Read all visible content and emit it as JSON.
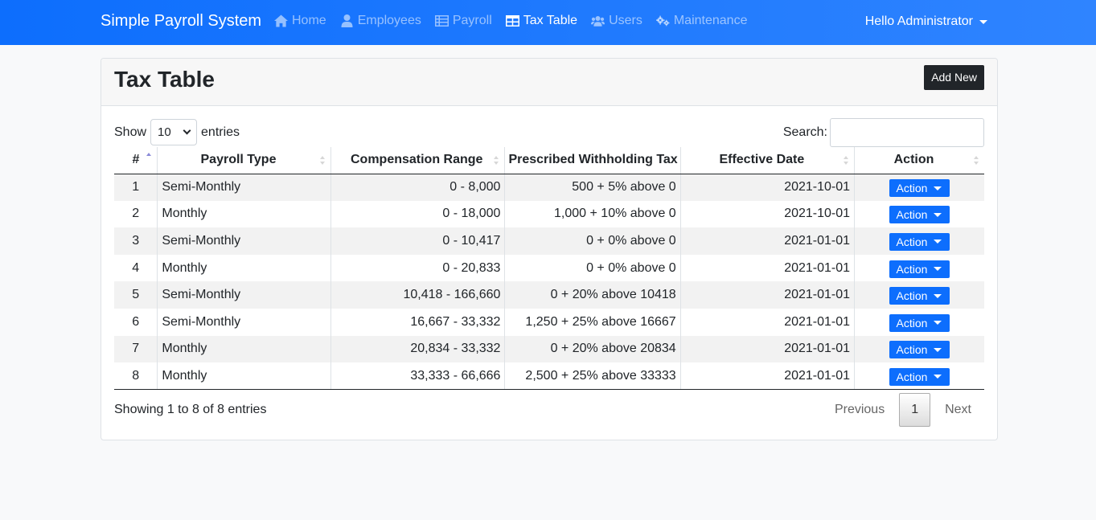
{
  "navbar": {
    "brand": "Simple Payroll System",
    "items": [
      {
        "label": "Home",
        "icon": "home-icon"
      },
      {
        "label": "Employees",
        "icon": "user-icon"
      },
      {
        "label": "Payroll",
        "icon": "table-list-icon"
      },
      {
        "label": "Tax Table",
        "icon": "table-icon",
        "active": true
      },
      {
        "label": "Users",
        "icon": "users-icon"
      },
      {
        "label": "Maintenance",
        "icon": "gears-icon"
      }
    ],
    "user_label": "Hello Administrator"
  },
  "page": {
    "title": "Tax Table",
    "add_button": "Add New"
  },
  "table_controls": {
    "show_label": "Show",
    "page_size": "10",
    "entries_label": "entries",
    "search_label": "Search:",
    "search_value": ""
  },
  "table": {
    "columns": [
      "#",
      "Payroll Type",
      "Compensation Range",
      "Prescribed Withholding Tax",
      "Effective Date",
      "Action"
    ],
    "action_label": "Action",
    "rows": [
      {
        "num": "1",
        "type": "Semi-Monthly",
        "range": "0 - 8,000",
        "tax": "500 + 5% above 0",
        "date": "2021-10-01"
      },
      {
        "num": "2",
        "type": "Monthly",
        "range": "0 - 18,000",
        "tax": "1,000 + 10% above 0",
        "date": "2021-10-01"
      },
      {
        "num": "3",
        "type": "Semi-Monthly",
        "range": "0 - 10,417",
        "tax": "0 + 0% above 0",
        "date": "2021-01-01"
      },
      {
        "num": "4",
        "type": "Monthly",
        "range": "0 - 20,833",
        "tax": "0 + 0% above 0",
        "date": "2021-01-01"
      },
      {
        "num": "5",
        "type": "Semi-Monthly",
        "range": "10,418 - 166,660",
        "tax": "0 + 20% above 10418",
        "date": "2021-01-01"
      },
      {
        "num": "6",
        "type": "Semi-Monthly",
        "range": "16,667 - 33,332",
        "tax": "1,250 + 25% above 16667",
        "date": "2021-01-01"
      },
      {
        "num": "7",
        "type": "Monthly",
        "range": "20,834 - 33,332",
        "tax": "0 + 20% above 20834",
        "date": "2021-01-01"
      },
      {
        "num": "8",
        "type": "Monthly",
        "range": "33,333 - 66,666",
        "tax": "2,500 + 25% above 33333",
        "date": "2021-01-01"
      }
    ]
  },
  "footer": {
    "info": "Showing 1 to 8 of 8 entries",
    "previous": "Previous",
    "current_page": "1",
    "next": "Next"
  },
  "colors": {
    "navbar": "#0d6efd",
    "action_button": "#0d6efd",
    "add_button": "#212529"
  }
}
